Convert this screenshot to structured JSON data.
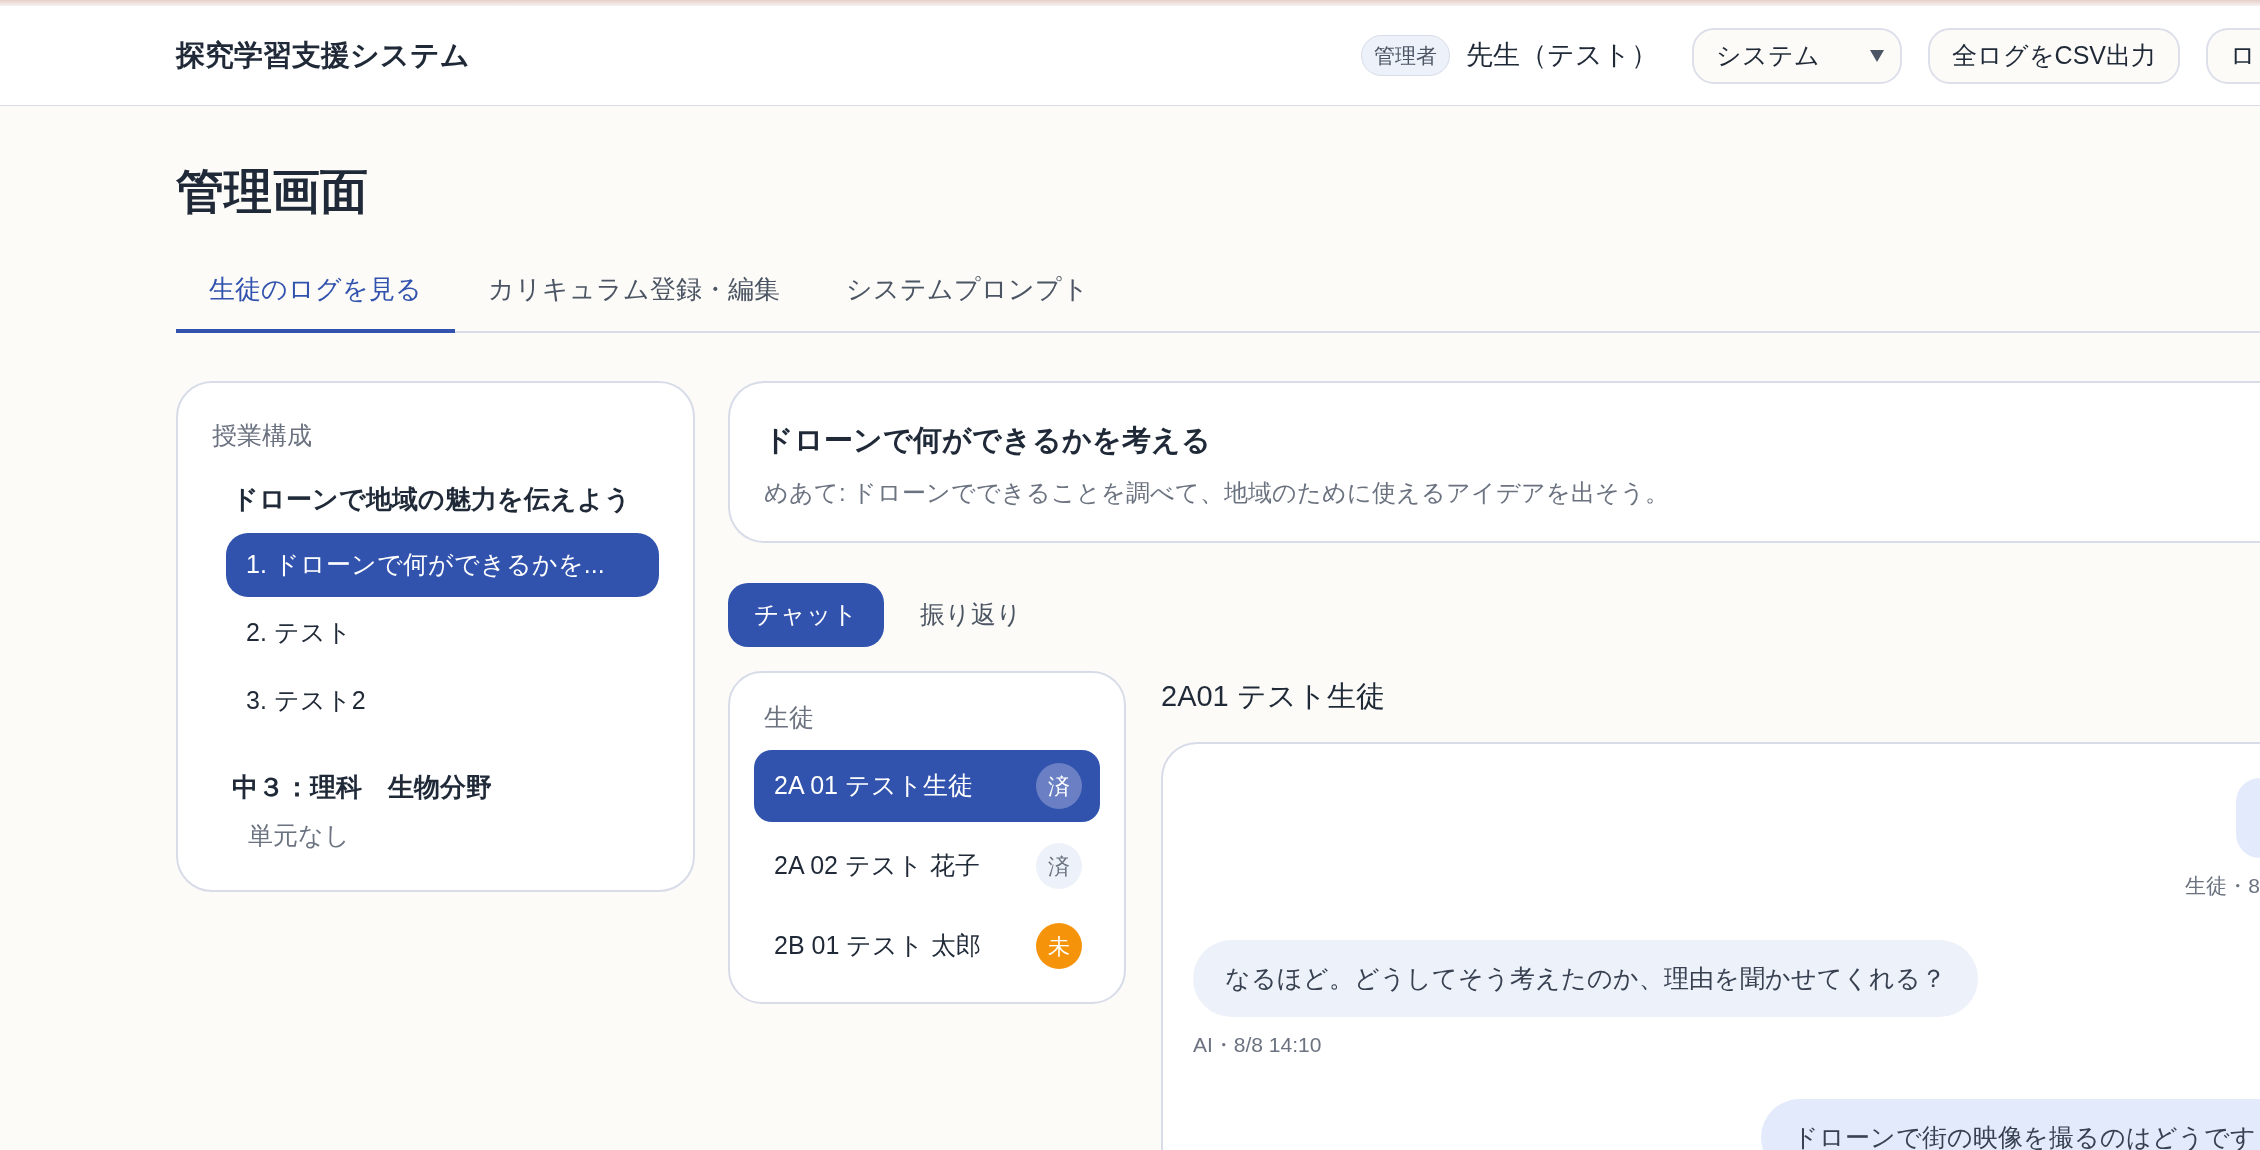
{
  "header": {
    "app_title": "探究学習支援システム",
    "role_badge": "管理者",
    "user_name": "先生（テスト）",
    "system_select": {
      "value": "システム"
    },
    "buttons": [
      "全ログをCSV出力",
      "ロ"
    ]
  },
  "page_title": "管理画面",
  "tabs": [
    {
      "label": "生徒のログを見る",
      "selected": true
    },
    {
      "label": "カリキュラム登録・編集",
      "selected": false
    },
    {
      "label": "システムプロンプト",
      "selected": false
    }
  ],
  "curriculum": {
    "heading": "授業構成",
    "groups": [
      {
        "title": "ドローンで地域の魅力を伝えよう",
        "lessons": [
          {
            "label": "1. ドローンで何ができるかを...",
            "selected": true
          },
          {
            "label": "2. テスト",
            "selected": false
          },
          {
            "label": "3. テスト2",
            "selected": false
          }
        ]
      },
      {
        "title": "中３：理科　生物分野",
        "empty_note": "単元なし"
      }
    ]
  },
  "lesson": {
    "title": "ドローンで何ができるかを考える",
    "goal": "めあて: ドローンでできることを調べて、地域のために使えるアイデアを出そう。"
  },
  "view_tabs": [
    {
      "label": "チャット",
      "selected": true
    },
    {
      "label": "振り返り",
      "selected": false
    }
  ],
  "students": {
    "heading": "生徒",
    "items": [
      {
        "name": "2A 01 テスト生徒",
        "status": "済",
        "kind": "done",
        "selected": true
      },
      {
        "name": "2A 02 テスト 花子",
        "status": "済",
        "kind": "done",
        "selected": false
      },
      {
        "name": "2B 01 テスト 太郎",
        "status": "未",
        "kind": "pending",
        "selected": false
      }
    ]
  },
  "chat": {
    "student_title": "2A01 テスト生徒",
    "messages": [
      {
        "kind": "student",
        "meta": "生徒・8"
      },
      {
        "kind": "ai",
        "text": "なるほど。どうしてそう考えたのか、理由を聞かせてくれる？",
        "meta": "AI・8/8 14:10"
      },
      {
        "kind": "student",
        "text": "ドローンで街の映像を撮るのはどうです"
      }
    ]
  }
}
